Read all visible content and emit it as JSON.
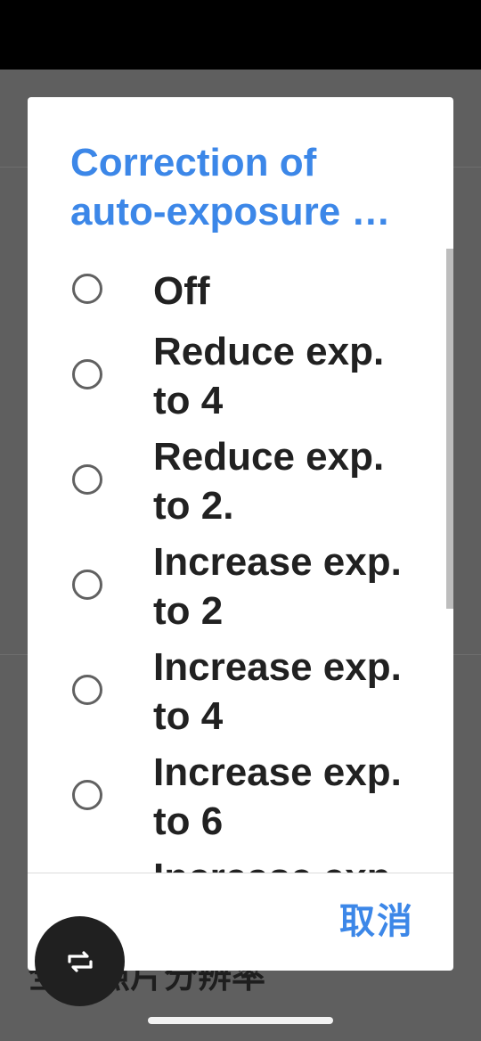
{
  "dialog": {
    "title_line1": "Correction of",
    "title_line2": "auto-exposure …",
    "options": [
      {
        "line1": "Off",
        "line2": ""
      },
      {
        "line1": "Reduce exp.",
        "line2": "to 4"
      },
      {
        "line1": "Reduce exp.",
        "line2": "to 2."
      },
      {
        "line1": "Increase exp.",
        "line2": "to 2"
      },
      {
        "line1": "Increase exp.",
        "line2": "to 4"
      },
      {
        "line1": "Increase exp.",
        "line2": "to 6"
      },
      {
        "line1": "Increase exp.",
        "line2": ""
      }
    ],
    "cancel_label": "取消"
  },
  "background": {
    "bottom_text": "全景照片分辨率"
  },
  "icons": {
    "fab": "switch-camera-icon",
    "radio": "radio-unchecked-icon"
  },
  "colors": {
    "accent": "#3c87e8",
    "status_bar": "#000000",
    "scrim": "#5f5f5f",
    "dialog_bg": "#ffffff",
    "text": "#212121",
    "fab": "#202020"
  }
}
